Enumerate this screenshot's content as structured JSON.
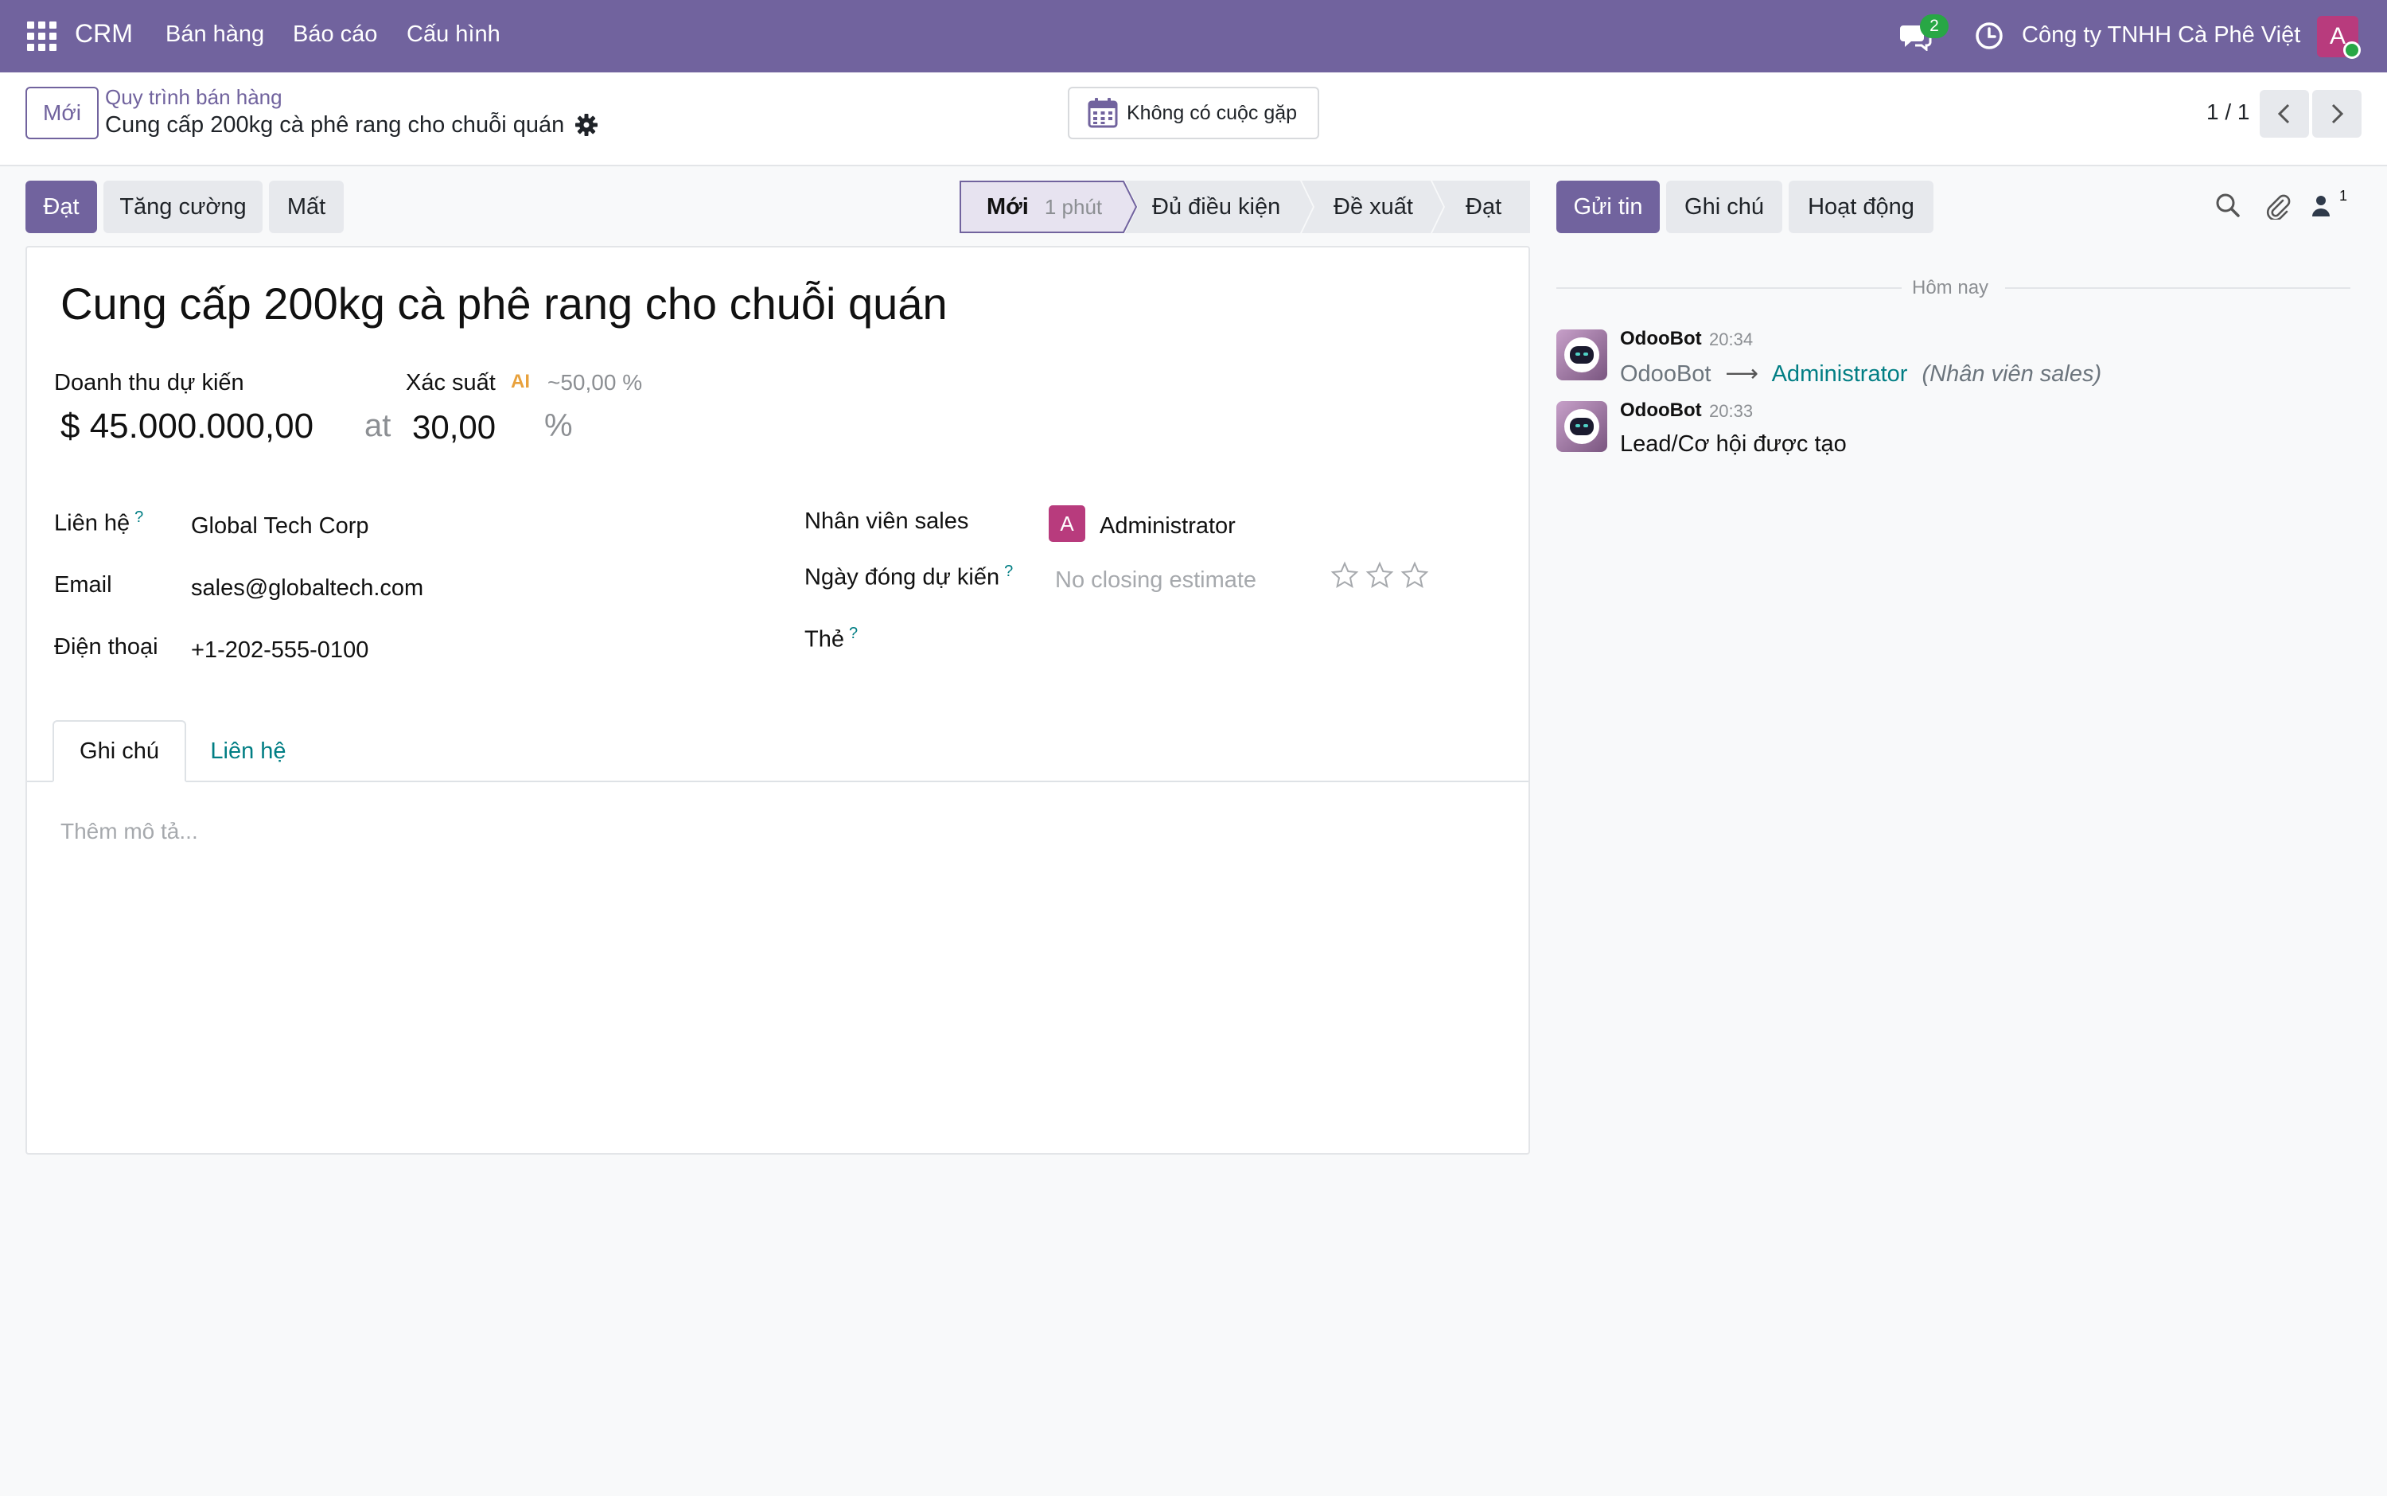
{
  "navbar": {
    "brand": "CRM",
    "menu": [
      "Bán hàng",
      "Báo cáo",
      "Cấu hình"
    ],
    "chat_badge": "2",
    "company": "Công ty TNHH Cà Phê Việt",
    "avatar_letter": "A",
    "color": "#71639e"
  },
  "control_panel": {
    "new_button": "Mới",
    "breadcrumb_parent": "Quy trình bán hàng",
    "breadcrumb_current": "Cung cấp 200kg cà phê rang cho chuỗi quán",
    "meeting_button": "Không có cuộc gặp",
    "pager": "1 / 1"
  },
  "statusbar": {
    "buttons": [
      "Đạt",
      "Tăng cường",
      "Mất"
    ],
    "stages": [
      {
        "label": "Mới",
        "duration": "1 phút",
        "active": true
      },
      {
        "label": "Đủ điều kiện",
        "active": false
      },
      {
        "label": "Đề xuất",
        "active": false
      },
      {
        "label": "Đạt",
        "active": false
      }
    ]
  },
  "form": {
    "title": "Cung cấp 200kg cà phê rang cho chuỗi quán",
    "expected_revenue_label": "Doanh thu dự kiến",
    "expected_revenue": "$ 45.000.000,00",
    "at": "at",
    "probability_label": "Xác suất",
    "ai_icon_text": "AI",
    "ai_probability": "~50,00 %",
    "probability": "30,00",
    "percent": "%",
    "contact_label": "Liên hệ",
    "contact": "Global Tech Corp",
    "email_label": "Email",
    "email": "sales@globaltech.com",
    "phone_label": "Điện thoại",
    "phone": "+1-202-555-0100",
    "salesperson_label": "Nhân viên sales",
    "salesperson_avatar": "A",
    "salesperson": "Administrator",
    "closing_label": "Ngày đóng dự kiến",
    "closing_placeholder": "No closing estimate",
    "tags_label": "Thẻ",
    "help_mark": "?",
    "tabs": [
      "Ghi chú",
      "Liên hệ"
    ],
    "notes_placeholder": "Thêm mô tả...",
    "priority_stars": 0
  },
  "chatter": {
    "buttons": [
      "Gửi tin",
      "Ghi chú",
      "Hoạt động"
    ],
    "follower_count": "1",
    "date_separator": "Hôm nay",
    "messages": [
      {
        "author": "OdooBot",
        "time": "20:34",
        "old_value": "OdooBot",
        "arrow": "⟶",
        "new_value": "Administrator",
        "field": "(Nhân viên sales)"
      },
      {
        "author": "OdooBot",
        "time": "20:33",
        "body": "Lead/Cơ hội được tạo"
      }
    ]
  }
}
